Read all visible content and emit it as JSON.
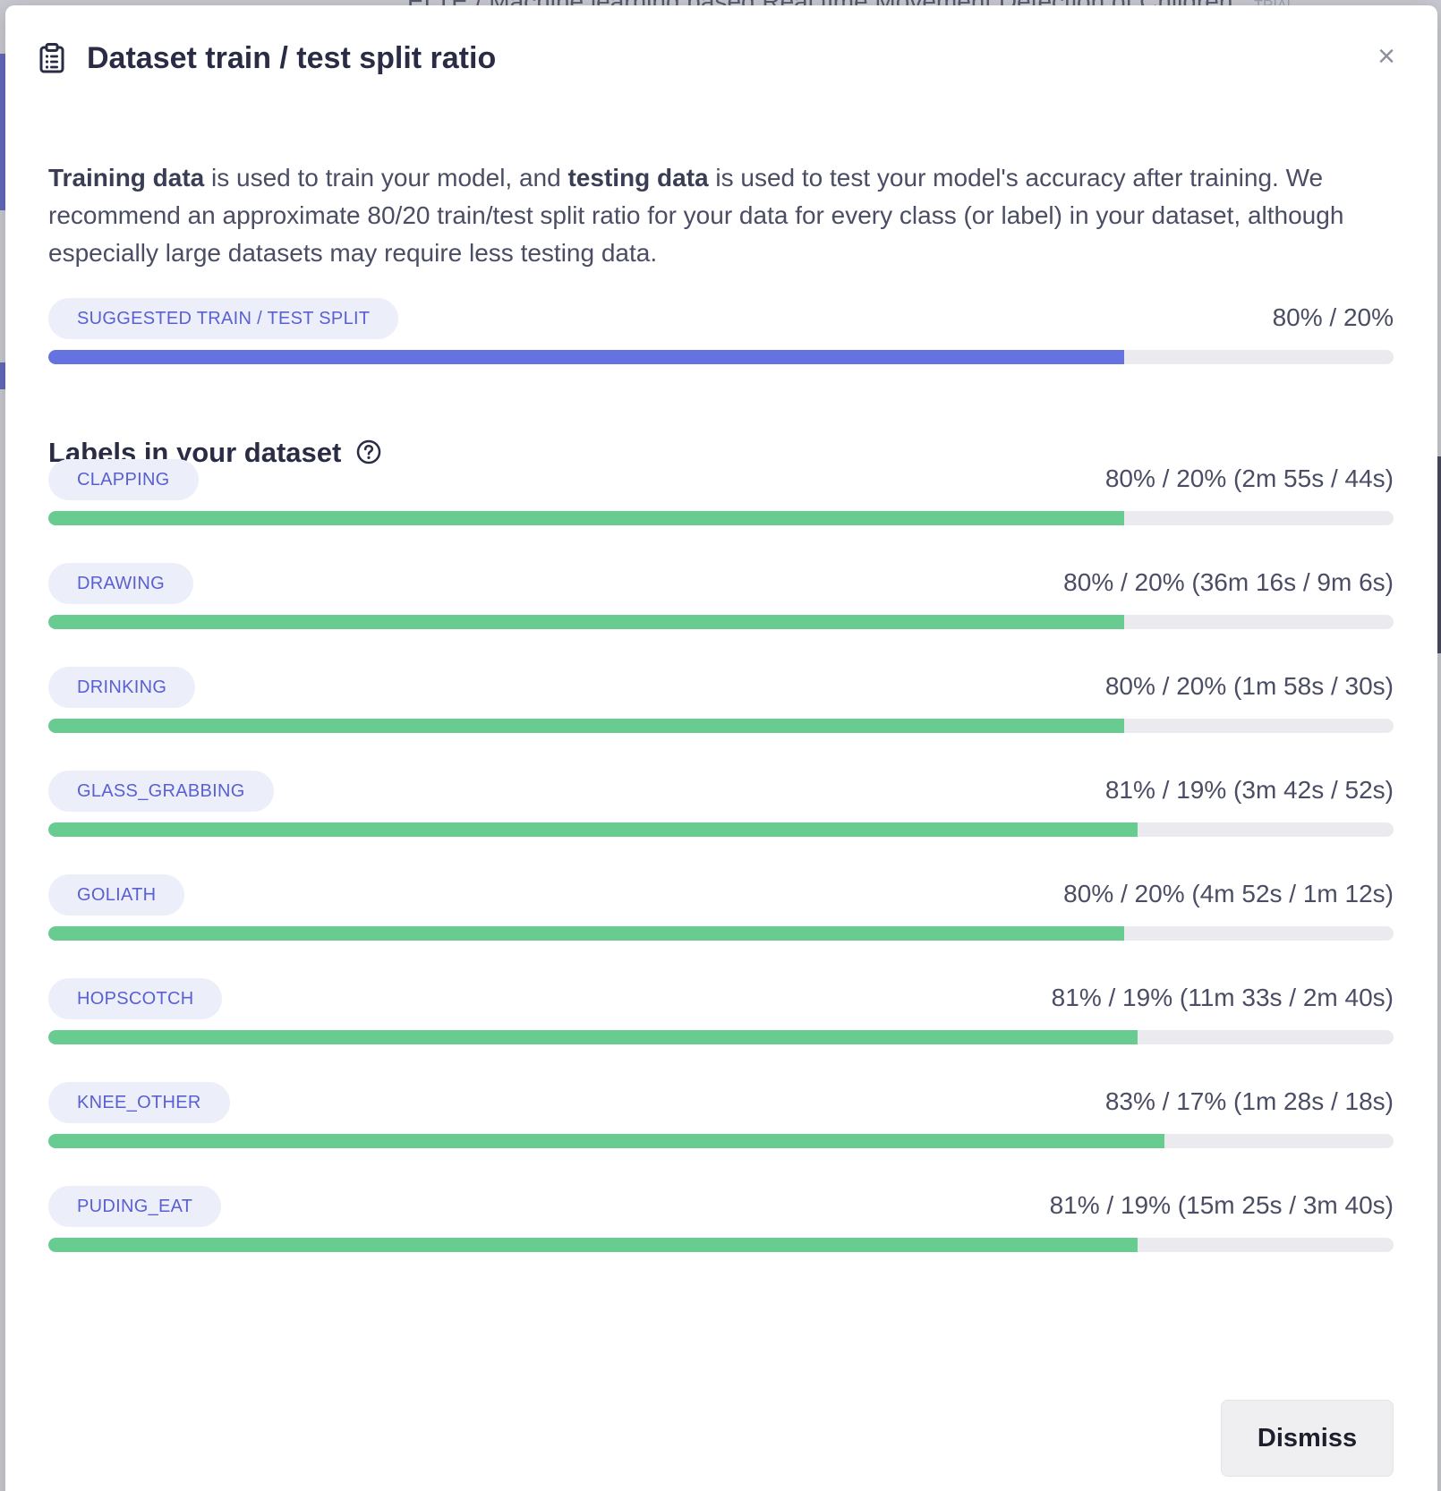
{
  "background": {
    "header_text": "ELTE / Machine learning based Real time Movement Detection of Children",
    "trial_badge": "TRIAL"
  },
  "modal": {
    "title": "Dataset train / test split ratio",
    "icon": "clipboard-icon",
    "close_icon": "close-icon",
    "close_label": "×",
    "intro": {
      "training_term": "Training data",
      "part1": " is used to train your model, and ",
      "testing_term": "testing data",
      "part2": " is used to test your model's accuracy after training. We recommend an approximate 80/20 train/test split ratio for your data for every class (or label) in your dataset, although especially large datasets may require less testing data."
    },
    "suggested": {
      "label": "SUGGESTED TRAIN / TEST SPLIT",
      "ratio_text": "80% / 20%",
      "train_fraction": 0.8,
      "color": "#6672e0"
    },
    "labels_section": {
      "title": "Labels in your dataset",
      "help_icon": "question-circle-icon"
    },
    "bar_color": "#68cc90",
    "labels": [
      {
        "name": "CLAPPING",
        "ratio_text": "80% / 20% (2m 55s / 44s)",
        "train_fraction": 0.8
      },
      {
        "name": "DRAWING",
        "ratio_text": "80% / 20% (36m 16s / 9m 6s)",
        "train_fraction": 0.8
      },
      {
        "name": "DRINKING",
        "ratio_text": "80% / 20% (1m 58s / 30s)",
        "train_fraction": 0.8
      },
      {
        "name": "GLASS_GRABBING",
        "ratio_text": "81% / 19% (3m 42s / 52s)",
        "train_fraction": 0.81
      },
      {
        "name": "GOLIATH",
        "ratio_text": "80% / 20% (4m 52s / 1m 12s)",
        "train_fraction": 0.8
      },
      {
        "name": "HOPSCOTCH",
        "ratio_text": "81% / 19% (11m 33s / 2m 40s)",
        "train_fraction": 0.81
      },
      {
        "name": "KNEE_OTHER",
        "ratio_text": "83% / 17% (1m 28s / 18s)",
        "train_fraction": 0.83
      },
      {
        "name": "PUDING_EAT",
        "ratio_text": "81% / 19% (15m 25s / 3m 40s)",
        "train_fraction": 0.81
      }
    ],
    "dismiss_label": "Dismiss"
  }
}
